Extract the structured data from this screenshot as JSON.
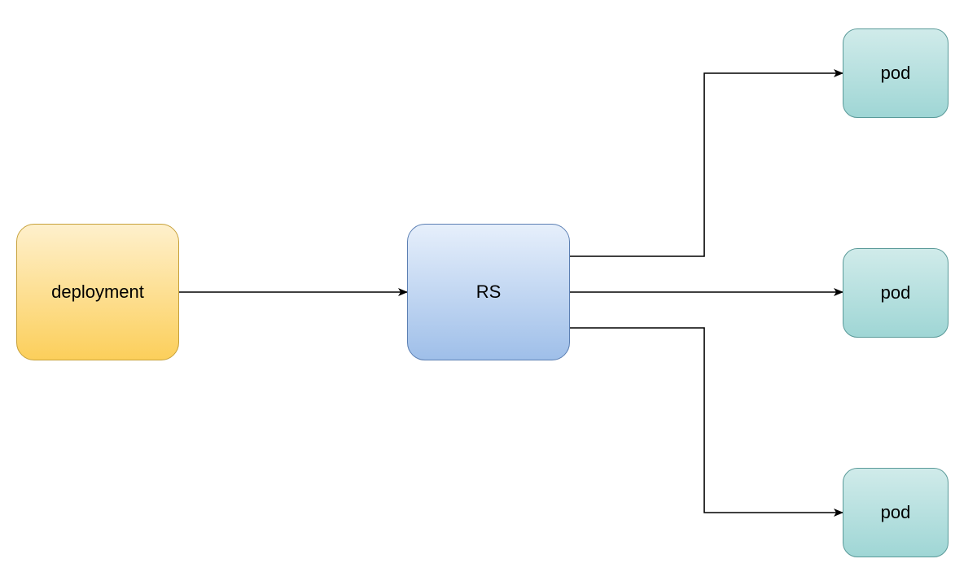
{
  "diagram": {
    "nodes": {
      "deployment": {
        "label": "deployment"
      },
      "rs": {
        "label": "RS"
      },
      "pod1": {
        "label": "pod"
      },
      "pod2": {
        "label": "pod"
      },
      "pod3": {
        "label": "pod"
      }
    },
    "edges": [
      {
        "from": "deployment",
        "to": "rs"
      },
      {
        "from": "rs",
        "to": "pod1"
      },
      {
        "from": "rs",
        "to": "pod2"
      },
      {
        "from": "rs",
        "to": "pod3"
      }
    ],
    "colors": {
      "deployment_fill_top": "#fef0cc",
      "deployment_fill_bottom": "#fccf5b",
      "deployment_border": "#c7a13a",
      "rs_fill_top": "#e6effb",
      "rs_fill_bottom": "#9fbfe9",
      "rs_border": "#5b7fb3",
      "pod_fill_top": "#d0ebea",
      "pod_fill_bottom": "#9fd6d5",
      "pod_border": "#5a9a99",
      "arrow": "#000000"
    }
  }
}
